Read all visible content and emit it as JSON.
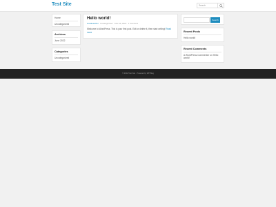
{
  "site": {
    "title": "Test Site",
    "search_placeholder": "Search"
  },
  "left_sidebar": {
    "menu": [
      "Home",
      "Uncategorized"
    ],
    "archives": {
      "title": "Archives",
      "items": [
        "June 2022"
      ]
    },
    "categories": {
      "title": "Categories",
      "items": [
        "Uncategorized"
      ]
    }
  },
  "post": {
    "title": "Hello world!",
    "author": "testsiteauthor",
    "category": "Uncategorized",
    "date": "June 14, 2022",
    "comments": "1 Comment",
    "excerpt": "Welcome to WordPress. This is your first post. Edit or delete it, then start writing!",
    "read_more": "Read more"
  },
  "right_sidebar": {
    "search_button": "Search",
    "recent_posts": {
      "title": "Recent Posts",
      "items": [
        "Hello world!"
      ]
    },
    "recent_comments": {
      "title": "Recent Comments",
      "items": [
        "A WordPress Commenter on Hello world!"
      ]
    }
  },
  "footer": {
    "text": "© 2022 Test Site · Powered by WP Blog"
  }
}
